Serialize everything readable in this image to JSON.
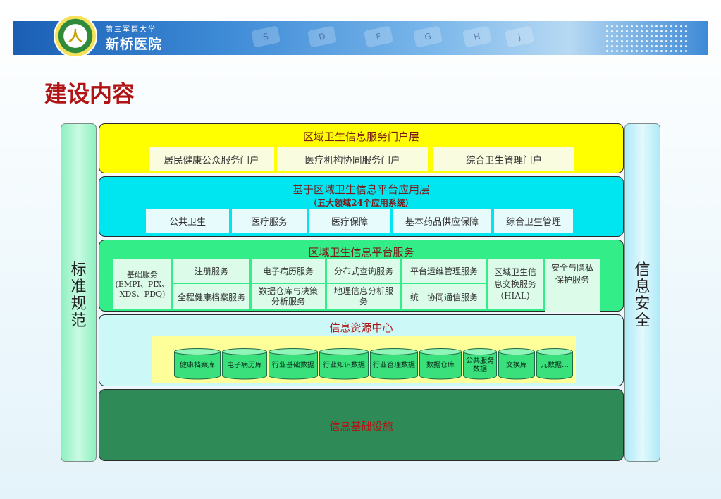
{
  "header": {
    "hospital_name": "新桥医院",
    "hospital_subtitle": "第三军医大学",
    "logo_mark": "人"
  },
  "title": "建设内容",
  "pillars": {
    "left": "标准规范",
    "right": "信息安全"
  },
  "portal_layer": {
    "title": "区域卫生信息服务门户层",
    "items": [
      "居民健康公众服务门户",
      "医疗机构协同服务门户",
      "综合卫生管理门户"
    ]
  },
  "app_layer": {
    "title": "基于区域卫生信息平台应用层",
    "subtitle": "（五大领域24个应用系统）",
    "items": [
      "公共卫生",
      "医疗服务",
      "医疗保障",
      "基本药品供应保障",
      "综合卫生管理"
    ]
  },
  "service_layer": {
    "title": "区域卫生信息平台服务",
    "base": "基础服务\n(EMPI、PIX、\nXDS、PDQ)",
    "top_row": [
      "注册服务",
      "电子病历服务",
      "分布式查询服务",
      "平台运维管理服务"
    ],
    "bottom_row": [
      "全程健康档案服务",
      "数据仓库与决策\n分析服务",
      "地理信息分析服\n务",
      "统一协同通信服务"
    ],
    "hial": "区域卫生信\n息交换服务\n（HIAL）",
    "security": "安全与隐私\n保护服务"
  },
  "resource_layer": {
    "title": "信息资源中心",
    "items": [
      "健康档案库",
      "电子病历库",
      "行业基础数据",
      "行业知识数据",
      "行业管理数据",
      "数据仓库",
      "公共服务\n数据",
      "交换库",
      "元数据…"
    ]
  },
  "infra_layer": {
    "title": "信息基础设施"
  },
  "colors": {
    "portal_bg": "#ffff00",
    "app_bg": "#00e6f0",
    "service_bg": "#33ee88",
    "resource_bg": "#ccf8f8",
    "infra_bg": "#2e8b57",
    "cylinder": "#39e07b",
    "title_red": "#b01414"
  }
}
